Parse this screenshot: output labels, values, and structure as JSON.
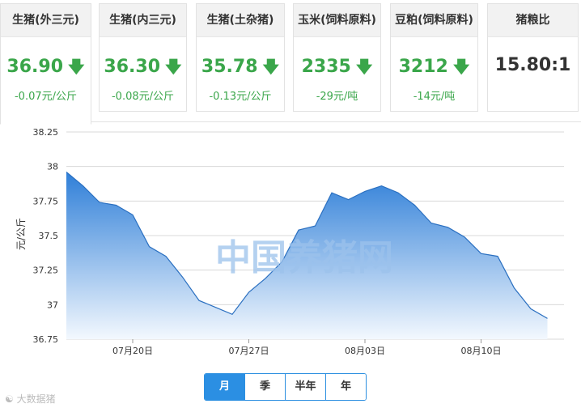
{
  "tabs": [
    {
      "title": "生猪(外三元)",
      "price": "36.90",
      "change": "-0.07元/公斤",
      "arrow": "down",
      "active": true
    },
    {
      "title": "生猪(内三元)",
      "price": "36.30",
      "change": "-0.08元/公斤",
      "arrow": "down",
      "active": false
    },
    {
      "title": "生猪(土杂猪)",
      "price": "35.78",
      "change": "-0.13元/公斤",
      "arrow": "down",
      "active": false
    },
    {
      "title": "玉米(饲料原料)",
      "price": "2335",
      "change": "-29元/吨",
      "arrow": "down",
      "active": false
    },
    {
      "title": "豆粕(饲料原料)",
      "price": "3212",
      "change": "-14元/吨",
      "arrow": "down",
      "active": false
    },
    {
      "title": "猪粮比",
      "price": "15.80:1",
      "change": "",
      "arrow": "",
      "active": false
    }
  ],
  "colors": {
    "down": "#3aa64a",
    "accent": "#2b8fe3",
    "area_top": "#2f7fd8",
    "area_bottom": "#f3f8fe",
    "watermark": "#9cc2ec"
  },
  "watermark": "中国养猪网",
  "footer_logo": "大数据猪",
  "range_buttons": [
    "月",
    "季",
    "半年",
    "年"
  ],
  "range_active": "月",
  "chart_data": {
    "type": "area",
    "ylabel": "元/公斤",
    "ylim": [
      36.75,
      38.25
    ],
    "yticks": [
      "38.25",
      "38",
      "37.75",
      "37.5",
      "37.25",
      "37",
      "36.75"
    ],
    "xtick_labels": [
      "07月20日",
      "07月27日",
      "08月03日",
      "08月10日"
    ],
    "xtick_positions": [
      4,
      11,
      18,
      25
    ],
    "x_count": 31,
    "values": [
      37.96,
      37.86,
      37.74,
      37.72,
      37.65,
      37.42,
      37.35,
      37.2,
      37.03,
      36.98,
      36.93,
      37.09,
      37.19,
      37.31,
      37.54,
      37.57,
      37.81,
      37.76,
      37.82,
      37.86,
      37.81,
      37.72,
      37.59,
      37.56,
      37.49,
      37.37,
      37.35,
      37.12,
      36.97,
      36.9
    ]
  }
}
